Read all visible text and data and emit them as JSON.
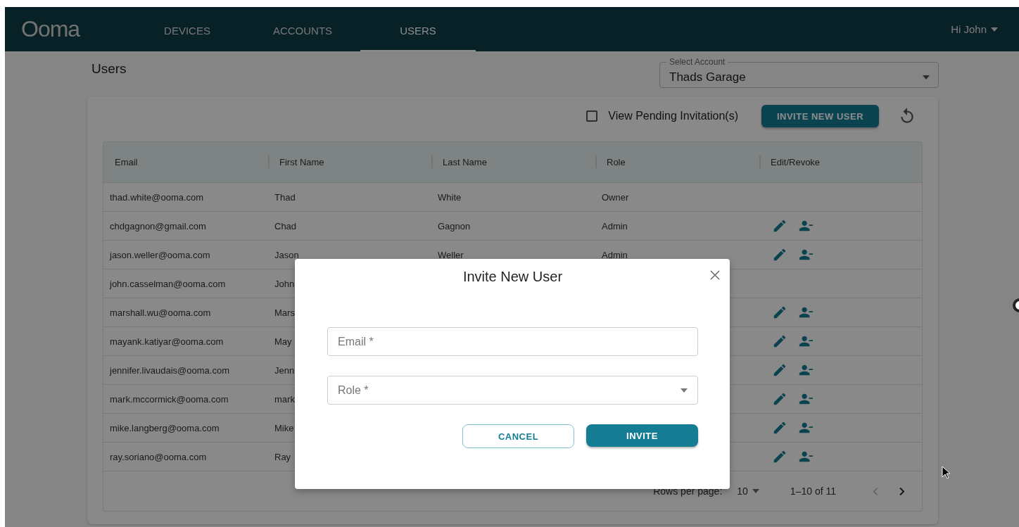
{
  "nav": {
    "logo": "Ooma",
    "tabs": [
      {
        "label": "DEVICES",
        "selected": false
      },
      {
        "label": "ACCOUNTS",
        "selected": false
      },
      {
        "label": "USERS",
        "selected": true
      }
    ],
    "user_menu": "Hi John"
  },
  "page": {
    "title": "Users",
    "account_select": {
      "label": "Select Account",
      "value": "Thads Garage"
    }
  },
  "toolbar": {
    "pending": {
      "label": "View Pending Invitation(s)",
      "checked": false
    },
    "invite_button": "INVITE NEW USER"
  },
  "table": {
    "columns": [
      "Email",
      "First Name",
      "Last Name",
      "Role",
      "Edit/Revoke"
    ],
    "rows": [
      {
        "email": "thad.white@ooma.com",
        "first_name": "Thad",
        "last_name": "White",
        "role": "Owner",
        "actions": false
      },
      {
        "email": "chdgagnon@gmail.com",
        "first_name": "Chad",
        "last_name": "Gagnon",
        "role": "Admin",
        "actions": true
      },
      {
        "email": "jason.weller@ooma.com",
        "first_name": "Jason",
        "last_name": "Weller",
        "role": "Admin",
        "actions": true
      },
      {
        "email": "john.casselman@ooma.com",
        "first_name": "John",
        "actions": false
      },
      {
        "email": "marshall.wu@ooma.com",
        "first_name": "Mars",
        "actions": true
      },
      {
        "email": "mayank.katiyar@ooma.com",
        "first_name": "May",
        "actions": true
      },
      {
        "email": "jennifer.livaudais@ooma.com",
        "first_name": "Jenn",
        "actions": true
      },
      {
        "email": "mark.mccormick@ooma.com",
        "first_name": "mark",
        "actions": true
      },
      {
        "email": "mike.langberg@ooma.com",
        "first_name": "Mike",
        "actions": true
      },
      {
        "email": "ray.soriano@ooma.com",
        "first_name": "Ray",
        "actions": true
      }
    ]
  },
  "pagination": {
    "rows_label": "Rows per page:",
    "rows_value": "10",
    "range": "1–10 of 11",
    "prev": {
      "disabled": true
    },
    "next": {
      "disabled": false
    }
  },
  "dialog": {
    "title": "Invite New User",
    "fields": [
      {
        "kind": "text",
        "placeholder": "Email *"
      },
      {
        "kind": "select",
        "placeholder": "Role *"
      }
    ],
    "buttons": [
      {
        "label": "CANCEL",
        "kind": "outlined"
      },
      {
        "label": "INVITE",
        "kind": "primary"
      }
    ]
  }
}
